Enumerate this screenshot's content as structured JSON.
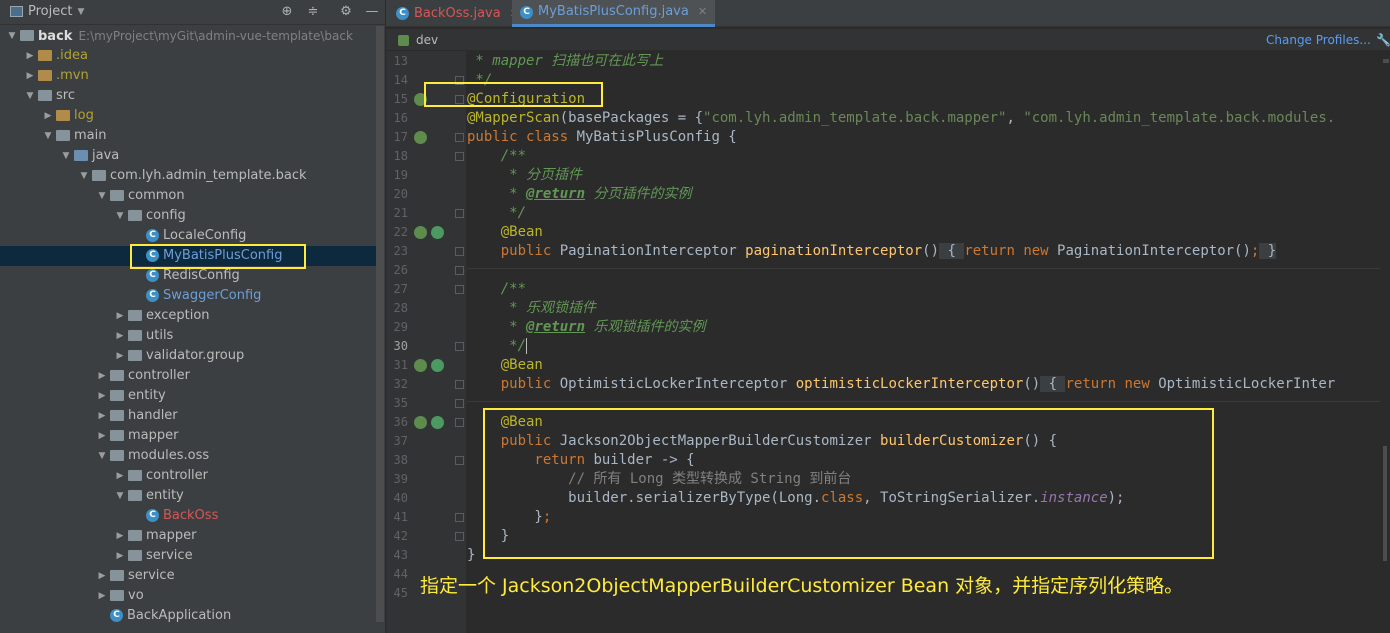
{
  "project_panel": {
    "title": "Project",
    "tree": [
      {
        "label": "back",
        "path": "E:\\myProject\\myGit\\admin-vue-template\\back",
        "indent": 0,
        "arrow": "down",
        "kind": "module"
      },
      {
        "label": ".idea",
        "indent": 1,
        "arrow": "right",
        "kind": "folder",
        "tone": "yellow"
      },
      {
        "label": ".mvn",
        "indent": 1,
        "arrow": "right",
        "kind": "folder",
        "tone": "yellow"
      },
      {
        "label": "src",
        "indent": 1,
        "arrow": "down",
        "kind": "folder"
      },
      {
        "label": "log",
        "indent": 2,
        "arrow": "right",
        "kind": "folder",
        "tone": "yellow"
      },
      {
        "label": "main",
        "indent": 2,
        "arrow": "down",
        "kind": "folder"
      },
      {
        "label": "java",
        "indent": 3,
        "arrow": "down",
        "kind": "folder-blue"
      },
      {
        "label": "com.lyh.admin_template.back",
        "indent": 4,
        "arrow": "down",
        "kind": "folder"
      },
      {
        "label": "common",
        "indent": 5,
        "arrow": "down",
        "kind": "folder"
      },
      {
        "label": "config",
        "indent": 6,
        "arrow": "down",
        "kind": "folder"
      },
      {
        "label": "LocaleConfig",
        "indent": 7,
        "arrow": "",
        "kind": "class"
      },
      {
        "label": "MyBatisPlusConfig",
        "indent": 7,
        "arrow": "",
        "kind": "class",
        "tone": "blue",
        "selected": true
      },
      {
        "label": "RedisConfig",
        "indent": 7,
        "arrow": "",
        "kind": "class"
      },
      {
        "label": "SwaggerConfig",
        "indent": 7,
        "arrow": "",
        "kind": "class",
        "tone": "blue"
      },
      {
        "label": "exception",
        "indent": 6,
        "arrow": "right",
        "kind": "folder"
      },
      {
        "label": "utils",
        "indent": 6,
        "arrow": "right",
        "kind": "folder"
      },
      {
        "label": "validator.group",
        "indent": 6,
        "arrow": "right",
        "kind": "folder"
      },
      {
        "label": "controller",
        "indent": 5,
        "arrow": "right",
        "kind": "folder"
      },
      {
        "label": "entity",
        "indent": 5,
        "arrow": "right",
        "kind": "folder"
      },
      {
        "label": "handler",
        "indent": 5,
        "arrow": "right",
        "kind": "folder"
      },
      {
        "label": "mapper",
        "indent": 5,
        "arrow": "right",
        "kind": "folder"
      },
      {
        "label": "modules.oss",
        "indent": 5,
        "arrow": "down",
        "kind": "folder"
      },
      {
        "label": "controller",
        "indent": 6,
        "arrow": "right",
        "kind": "folder"
      },
      {
        "label": "entity",
        "indent": 6,
        "arrow": "down",
        "kind": "folder"
      },
      {
        "label": "BackOss",
        "indent": 7,
        "arrow": "",
        "kind": "class",
        "tone": "red"
      },
      {
        "label": "mapper",
        "indent": 6,
        "arrow": "right",
        "kind": "folder"
      },
      {
        "label": "service",
        "indent": 6,
        "arrow": "right",
        "kind": "folder"
      },
      {
        "label": "service",
        "indent": 5,
        "arrow": "right",
        "kind": "folder"
      },
      {
        "label": "vo",
        "indent": 5,
        "arrow": "right",
        "kind": "folder"
      },
      {
        "label": "BackApplication",
        "indent": 5,
        "arrow": "",
        "kind": "class-app"
      }
    ]
  },
  "editor": {
    "tabs": [
      {
        "label": "BackOss.java",
        "active": false,
        "tone": "red"
      },
      {
        "label": "MyBatisPlusConfig.java",
        "active": true,
        "tone": "blue"
      }
    ],
    "branch": "dev",
    "change_profiles": "Change Profiles...",
    "current_line": "30",
    "lines": [
      {
        "n": "13",
        "tokens": [
          [
            "cm",
            " * mapper 扫描也可在此写上"
          ]
        ]
      },
      {
        "n": "14",
        "tokens": [
          [
            "cm",
            " */"
          ]
        ]
      },
      {
        "n": "15",
        "tokens": [
          [
            "ann",
            "@Configuration"
          ]
        ]
      },
      {
        "n": "16",
        "tokens": [
          [
            "ann",
            "@MapperScan"
          ],
          [
            "",
            "(basePackages = {"
          ],
          [
            "str",
            "\"com.lyh.admin_template.back.mapper\""
          ],
          [
            "",
            ", "
          ],
          [
            "str",
            "\"com.lyh.admin_template.back.modules."
          ]
        ]
      },
      {
        "n": "17",
        "tokens": [
          [
            "kw",
            "public class "
          ],
          [
            "",
            "MyBatisPlusConfig {"
          ]
        ]
      },
      {
        "n": "18",
        "tokens": [
          [
            "cm",
            "    /**"
          ]
        ]
      },
      {
        "n": "19",
        "tokens": [
          [
            "cm",
            "     * 分页插件"
          ]
        ]
      },
      {
        "n": "20",
        "tokens": [
          [
            "cm",
            "     * "
          ],
          [
            "cmtag",
            "@return"
          ],
          [
            "cm",
            " 分页插件的实例"
          ]
        ]
      },
      {
        "n": "21",
        "tokens": [
          [
            "cm",
            "     */"
          ]
        ]
      },
      {
        "n": "22",
        "tokens": [
          [
            "ann",
            "    @Bean"
          ]
        ]
      },
      {
        "n": "23",
        "tokens": [
          [
            "kw",
            "    public "
          ],
          [
            "",
            "PaginationInterceptor "
          ],
          [
            "fn",
            "paginationInterceptor"
          ],
          [
            "",
            "()"
          ],
          [
            "fold-hint",
            " { "
          ],
          [
            "kw",
            "return new "
          ],
          [
            "",
            "PaginationInterceptor()"
          ],
          [
            "kw",
            ";"
          ],
          [
            "fold-hint",
            " }"
          ]
        ]
      },
      {
        "n": "26",
        "tokens": []
      },
      {
        "n": "27",
        "tokens": [
          [
            "cm",
            "    /**"
          ]
        ]
      },
      {
        "n": "28",
        "tokens": [
          [
            "cm",
            "     * 乐观锁插件"
          ]
        ]
      },
      {
        "n": "29",
        "tokens": [
          [
            "cm",
            "     * "
          ],
          [
            "cmtag",
            "@return"
          ],
          [
            "cm",
            " 乐观锁插件的实例"
          ]
        ]
      },
      {
        "n": "30",
        "tokens": [
          [
            "cm",
            "     */"
          ]
        ]
      },
      {
        "n": "31",
        "tokens": [
          [
            "ann",
            "    @Bean"
          ]
        ]
      },
      {
        "n": "32",
        "tokens": [
          [
            "kw",
            "    public "
          ],
          [
            "",
            "OptimisticLockerInterceptor "
          ],
          [
            "fn",
            "optimisticLockerInterceptor"
          ],
          [
            "",
            "()"
          ],
          [
            "fold-hint",
            " { "
          ],
          [
            "kw",
            "return new "
          ],
          [
            "",
            "OptimisticLockerInter"
          ]
        ]
      },
      {
        "n": "35",
        "tokens": []
      },
      {
        "n": "36",
        "tokens": [
          [
            "ann",
            "    @Bean"
          ]
        ]
      },
      {
        "n": "37",
        "tokens": [
          [
            "kw",
            "    public "
          ],
          [
            "",
            "Jackson2ObjectMapperBuilderCustomizer "
          ],
          [
            "fn",
            "builderCustomizer"
          ],
          [
            "",
            "() {"
          ]
        ]
      },
      {
        "n": "38",
        "tokens": [
          [
            "kw",
            "        return "
          ],
          [
            "",
            "builder -> {"
          ]
        ]
      },
      {
        "n": "39",
        "tokens": [
          [
            "lc",
            "            // 所有 Long 类型转换成 String 到前台"
          ]
        ]
      },
      {
        "n": "40",
        "tokens": [
          [
            "",
            "            builder.serializerByType(Long."
          ],
          [
            "kw",
            "class"
          ],
          [
            "",
            ", ToStringSerializer."
          ],
          [
            "fld",
            "instance"
          ],
          [
            "",
            ");"
          ]
        ]
      },
      {
        "n": "41",
        "tokens": [
          [
            "",
            "        }"
          ],
          [
            "kw",
            ";"
          ]
        ]
      },
      {
        "n": "42",
        "tokens": [
          [
            "",
            "    }"
          ]
        ]
      },
      {
        "n": "43",
        "tokens": [
          [
            "",
            "}"
          ]
        ]
      },
      {
        "n": "44",
        "tokens": []
      },
      {
        "n": "45",
        "tokens": []
      }
    ],
    "caption": "指定一个 Jackson2ObjectMapperBuilderCustomizer Bean 对象，并指定序列化策略。"
  }
}
